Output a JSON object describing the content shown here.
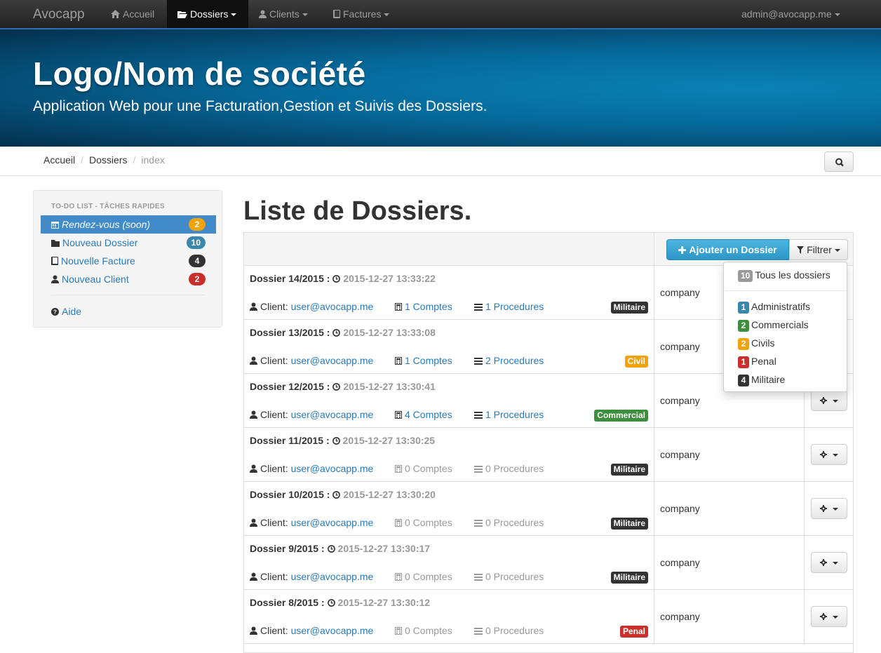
{
  "colors": {
    "primary": "#428bca",
    "info": "#2c96c8",
    "success": "#3c8f3c",
    "warning": "#f0a30a",
    "danger": "#c9302c",
    "dark": "#333333",
    "gray": "#999999"
  },
  "navbar": {
    "brand": "Avocapp",
    "items": [
      {
        "label": "Accueil",
        "icon": "home-icon"
      },
      {
        "label": "Dossiers",
        "icon": "folder-open-icon"
      },
      {
        "label": "Clients",
        "icon": "user-icon"
      },
      {
        "label": "Factures",
        "icon": "book-icon"
      }
    ],
    "user": "admin@avocapp.me"
  },
  "jumbotron": {
    "title": "Logo/Nom de société",
    "subtitle": "Application Web pour une Facturation,Gestion et Suivis des Dossiers."
  },
  "breadcrumb": [
    "Accueil",
    "Dossiers",
    "index"
  ],
  "sidebar": {
    "heading": "TO-DO LIST - TÂCHES RAPIDES",
    "items": [
      {
        "label": "Rendez-vous (soon)",
        "count": "2",
        "icon": "calendar-icon"
      },
      {
        "label": "Nouveau Dossier",
        "count": "10",
        "icon": "folder-icon"
      },
      {
        "label": "Nouvelle Facture",
        "count": "4",
        "icon": "book-icon"
      },
      {
        "label": "Nouveau Client",
        "count": "2",
        "icon": "user-icon"
      }
    ],
    "help": "Aide"
  },
  "main": {
    "title": "Liste de Dossiers.",
    "add_button": "Ajouter un Dossier",
    "filter_button": "Filtrer"
  },
  "filter_menu": {
    "all": {
      "count": "10",
      "label": "Tous les dossiers"
    },
    "items": [
      {
        "count": "1",
        "label": "Administratifs"
      },
      {
        "count": "2",
        "label": "Commercials"
      },
      {
        "count": "2",
        "label": "Civils"
      },
      {
        "count": "1",
        "label": "Penal"
      },
      {
        "count": "4",
        "label": "Militaire"
      }
    ]
  },
  "labels": {
    "client_prefix": "Client:",
    "colon": ":"
  },
  "dossiers": [
    {
      "name": "Dossier 14/2015",
      "date": "2015-12-27 13:33:22",
      "client": "user@avocapp.me",
      "comptes": "1 Comptes",
      "procedures": "1 Procedures",
      "type": "Militaire",
      "company": "company"
    },
    {
      "name": "Dossier 13/2015",
      "date": "2015-12-27 13:33:08",
      "client": "user@avocapp.me",
      "comptes": "1 Comptes",
      "procedures": "2 Procedures",
      "type": "Civil",
      "company": "company"
    },
    {
      "name": "Dossier 12/2015",
      "date": "2015-12-27 13:30:41",
      "client": "user@avocapp.me",
      "comptes": "4 Comptes",
      "procedures": "1 Procedures",
      "type": "Commercial",
      "company": "company"
    },
    {
      "name": "Dossier 11/2015",
      "date": "2015-12-27 13:30:25",
      "client": "user@avocapp.me",
      "comptes": "0 Comptes",
      "procedures": "0 Procedures",
      "type": "Militaire",
      "company": "company"
    },
    {
      "name": "Dossier 10/2015",
      "date": "2015-12-27 13:30:20",
      "client": "user@avocapp.me",
      "comptes": "0 Comptes",
      "procedures": "0 Procedures",
      "type": "Militaire",
      "company": "company"
    },
    {
      "name": "Dossier 9/2015",
      "date": "2015-12-27 13:30:17",
      "client": "user@avocapp.me",
      "comptes": "0 Comptes",
      "procedures": "0 Procedures",
      "type": "Militaire",
      "company": "company"
    },
    {
      "name": "Dossier 8/2015",
      "date": "2015-12-27 13:30:12",
      "client": "user@avocapp.me",
      "comptes": "0 Comptes",
      "procedures": "0 Procedures",
      "type": "Penal",
      "company": "company"
    }
  ]
}
